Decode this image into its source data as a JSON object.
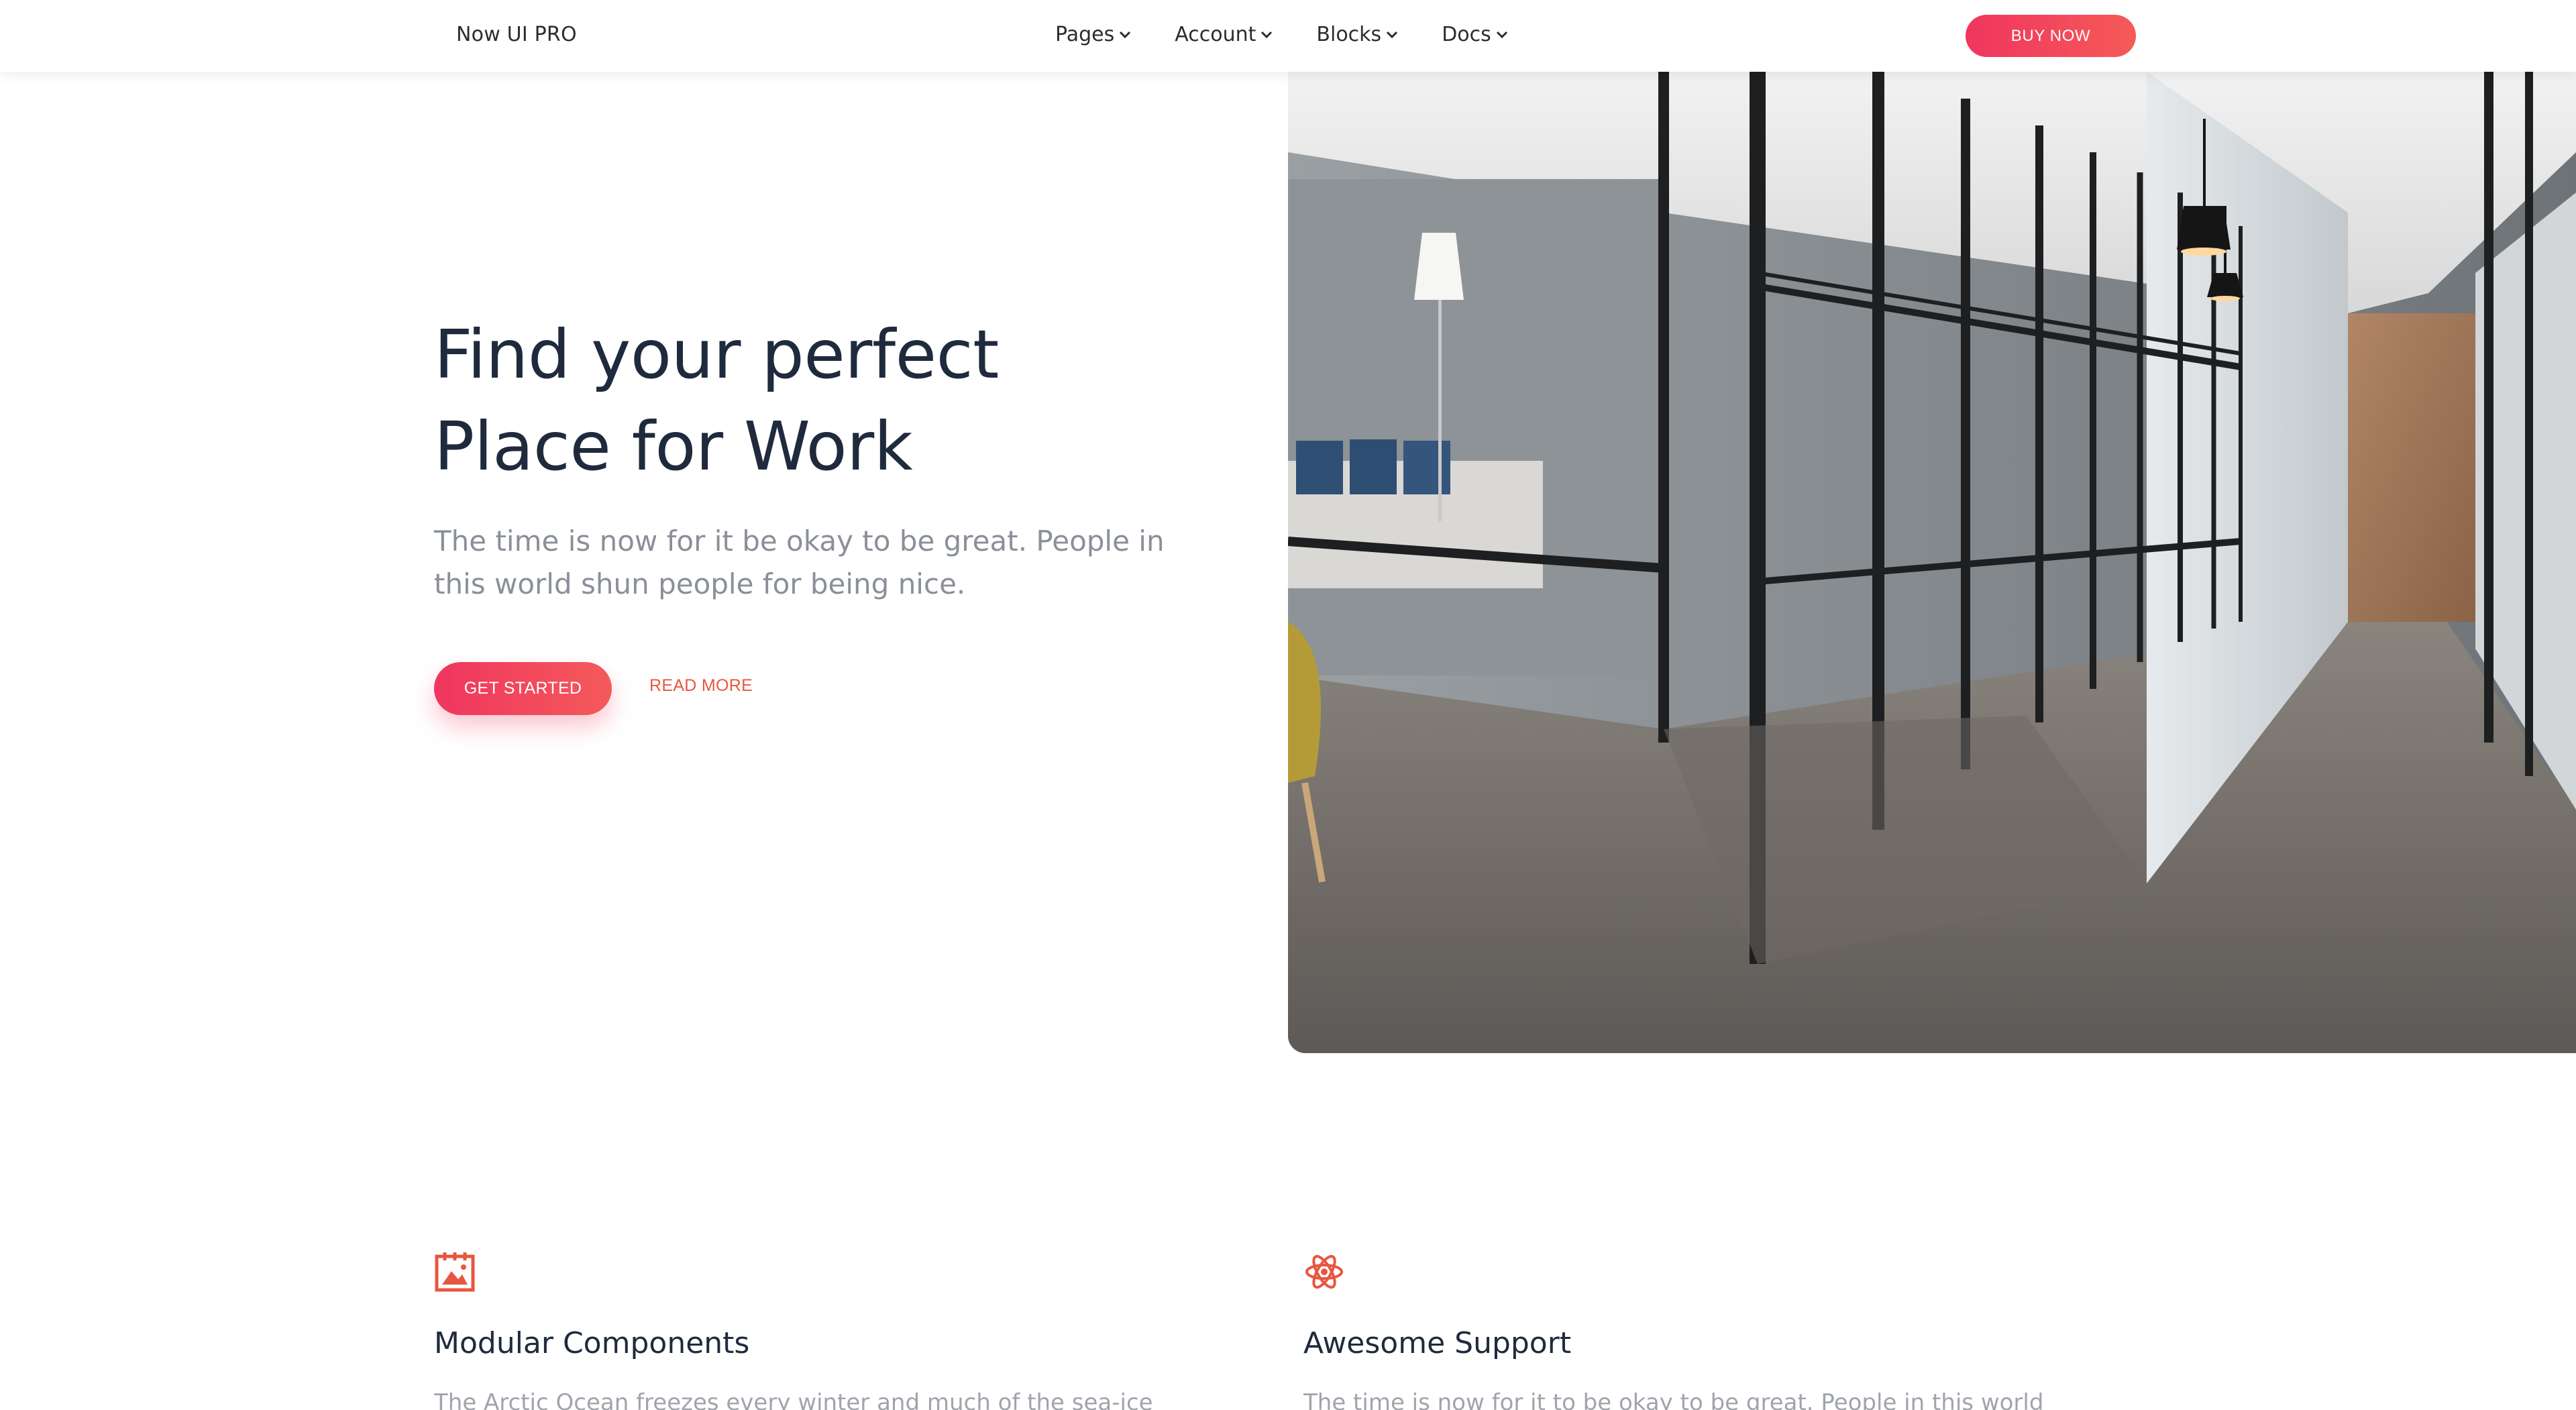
{
  "navbar": {
    "brand": "Now UI PRO",
    "items": [
      {
        "label": "Pages"
      },
      {
        "label": "Account"
      },
      {
        "label": "Blocks"
      },
      {
        "label": "Docs"
      }
    ],
    "buy_label": "BUY NOW"
  },
  "hero": {
    "title_line1": "Find your perfect",
    "title_line2": "Place for Work",
    "description": "The time is now for it be okay to be great. People in this world shun people for being nice.",
    "primary_button": "GET STARTED",
    "secondary_button": "READ MORE"
  },
  "features": [
    {
      "icon": "image-calendar-icon",
      "title": "Modular Components",
      "text": "The Arctic Ocean freezes every winter and much of the sea-ice then thaws"
    },
    {
      "icon": "atom-icon",
      "title": "Awesome Support",
      "text": "The time is now for it to be okay to be great. People in this world shun people"
    }
  ],
  "colors": {
    "accent": "#f0355f",
    "accent_end": "#f55a57",
    "link": "#e8563f",
    "heading": "#1f2a3d",
    "muted": "#8a8f99"
  }
}
